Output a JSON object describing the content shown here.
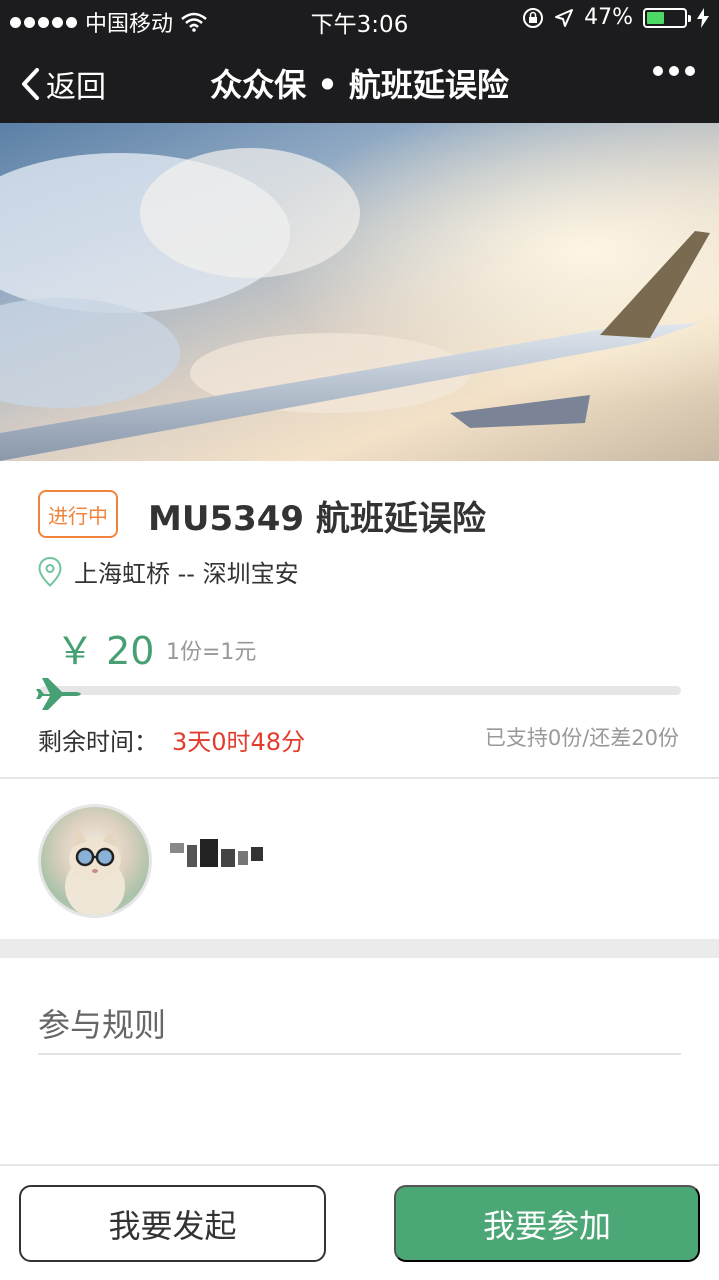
{
  "status_bar": {
    "carrier": "中国移动",
    "time": "下午3:06",
    "battery": "47%",
    "battery_level": 0.47,
    "icons": [
      "signal-dots-icon",
      "wifi-icon",
      "rotation-lock-icon",
      "location-arrow-icon",
      "battery-icon",
      "charging-icon"
    ]
  },
  "nav": {
    "back_label": "返回",
    "title": "众众保 • 航班延误险"
  },
  "product": {
    "status_tag": "进行中",
    "title": "MU5349 航班延误险",
    "route": "上海虹桥 -- 深圳宝安",
    "price": "￥ 20",
    "unit_note": "1份=1元",
    "progress": 0.0,
    "remaining_label": "剩余时间：",
    "remaining_value": "3天0时48分",
    "support_text": "已支持0份/还差20份"
  },
  "rules": {
    "title": "参与规则"
  },
  "footer": {
    "start_label": "我要发起",
    "join_label": "我要参加"
  },
  "colors": {
    "accent_green": "#47a073",
    "tag_orange": "#f0843c",
    "countdown_red": "#e23c2c",
    "bar_dark": "#1c1c1e"
  }
}
